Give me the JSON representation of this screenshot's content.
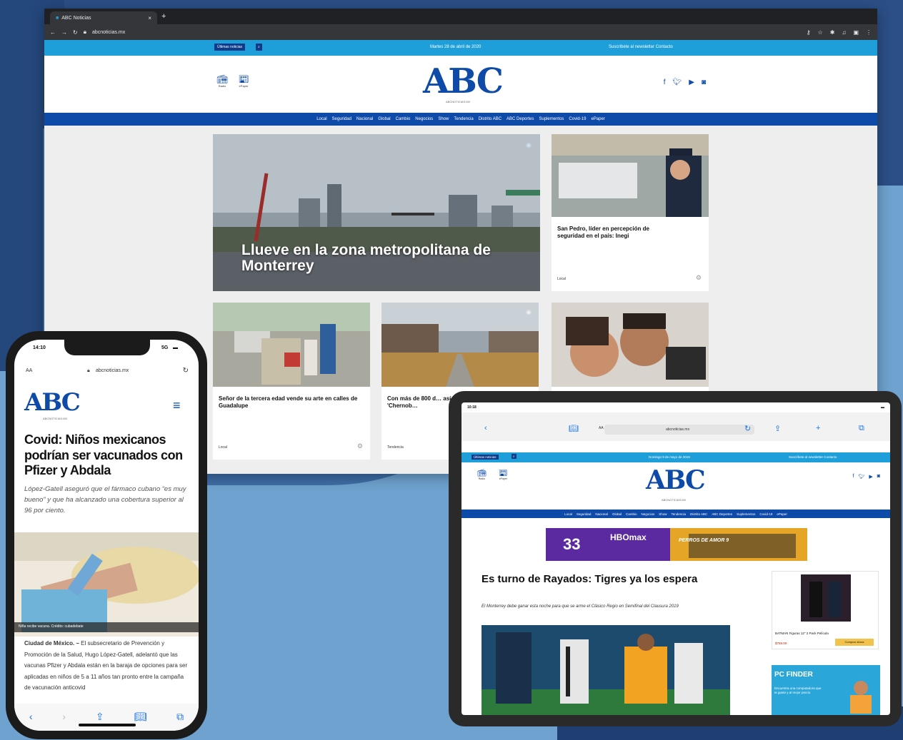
{
  "desktop": {
    "tab_title": "ABC Noticias",
    "url": "abcnoticias.mx",
    "topbar": {
      "left_button": "Últimas noticias",
      "date": "Martes 28 de abril de 2020",
      "links": "Suscríbete al newsletter  Contacto"
    },
    "masthead": {
      "logo": "ABC",
      "logo_sub": "ABCNOTICIAS.MX",
      "icon1_label": "Radio",
      "icon2_label": "ePaper"
    },
    "nav": [
      "Local",
      "Seguridad",
      "Nacional",
      "Global",
      "Cambio",
      "Negocios",
      "Show",
      "Tendencia",
      "Distrito ABC",
      "ABC Deportes",
      "Suplementos",
      "Covid-19",
      "ePaper"
    ],
    "hero": {
      "title": "Llueve en la zona metropolitana de Monterrey"
    },
    "cards": [
      {
        "title": "San Pedro, líder en percepción de seguridad en el país: Inegi",
        "category": "Local"
      },
      {
        "title": "Señor de la tercera edad vende su arte en calles de Guadalupe",
        "category": "Local"
      },
      {
        "title": "Con más de 800 d… así es el 'Chernob…",
        "category": "Tendencia"
      }
    ]
  },
  "phone": {
    "time": "14:10",
    "status_right": "5G",
    "text_size": "AA",
    "url": "abcnoticias.mx",
    "logo": "ABC",
    "logo_sub": "ABCNOTICIAS.MX",
    "title": "Covid: Niños mexicanos podrían ser vacunados con Pfizer y Abdala",
    "subtitle": "López-Gatell aseguró que el fármaco cubano “es muy bueno” y que ha alcanzado una cobertura superior al 96 por ciento.",
    "caption": "Niña recibe vacuna. Crédito: cubadebate",
    "body_lead": "Ciudad de México. –",
    "body": "El subsecretario de Prevención y Promoción de la Salud, Hugo López-Gatell, adelantó que las vacunas Pfizer y Abdala están en la baraja de opciones para ser aplicadas en niños de 5 a 11 años tan pronto entre la campaña de vacunación anticovid"
  },
  "tablet": {
    "time": "10:18",
    "text_size": "AA",
    "url": "abcnoticias.mx",
    "topbar_left": "Últimas noticias",
    "topbar_date": "Domingo 9 de mayo de 2019",
    "topbar_links": "Suscríbete al newsletter  Contacto",
    "logo": "ABC",
    "logo_sub": "ABCNOTICIAS.MX",
    "icon1_label": "Radio",
    "icon2_label": "ePaper",
    "nav": [
      "Local",
      "Seguridad",
      "Nacional",
      "Global",
      "Cambio",
      "Negocios",
      "Show",
      "Tendencia",
      "Distrito ABC",
      "ABC Deportes",
      "Suplementos",
      "Covid-19",
      "ePaper"
    ],
    "ad": {
      "percent": "33",
      "brand": "HBOmax",
      "show": "PERROS DE AMOR 9"
    },
    "title": "Es turno de Rayados: Tigres ya los espera",
    "subtitle": "El Monterrey debe ganar esta noche para que se arme el Clásico Regio en Semifinal del Clausura 2019",
    "side_product": "BATMAN Figuras 12\" 2 Pack Película",
    "side_price": "$759.00",
    "side_button": "Comprar ahora",
    "side_ad": "PC FINDER",
    "side_ad_text": "Encuentra una computadora que te guste y al mejor precio"
  },
  "colors": {
    "brand": "#0e4aa8",
    "topbar": "#1e9fd9"
  }
}
